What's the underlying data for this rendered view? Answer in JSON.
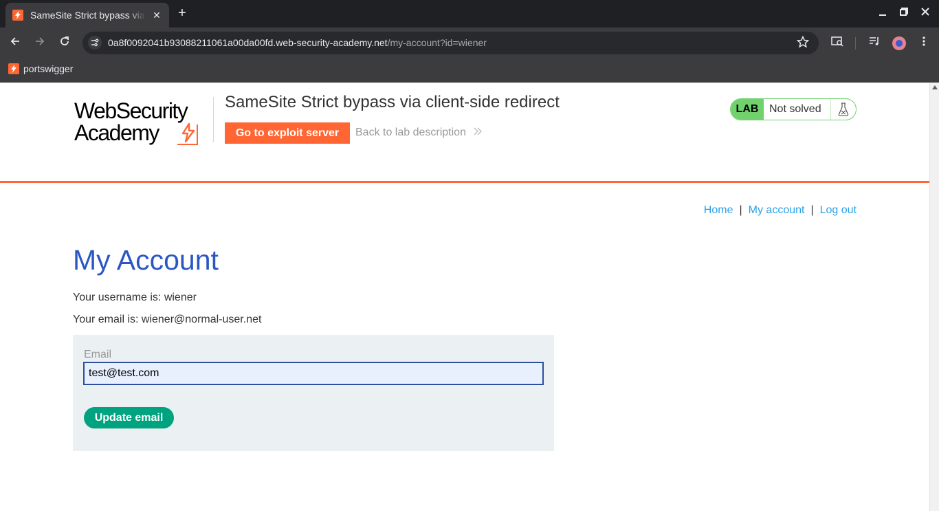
{
  "browser": {
    "tab_title": "SameSite Strict bypass via client-side redirect",
    "tab_close": "✕",
    "new_tab": "+",
    "url_host": "0a8f0092041b93088211061a00da00fd.web-security-academy.net",
    "url_path": "/my-account?id=wiener",
    "bookmark": "portswigger",
    "favicon_color": "#ff6633"
  },
  "lab_header": {
    "logo_line1": "WebSecurity",
    "logo_line2": "Academy",
    "title": "SameSite Strict bypass via client-side redirect",
    "exploit_button": "Go to exploit server",
    "back_link": "Back to lab description",
    "badge_lab": "LAB",
    "badge_status": "Not solved"
  },
  "nav": {
    "home": "Home",
    "my_account": "My account",
    "log_out": "Log out",
    "separator": "|"
  },
  "account": {
    "heading": "My Account",
    "username_text": "Your username is: wiener",
    "email_text": "Your email is: wiener@normal-user.net",
    "email_label": "Email",
    "email_value": "test@test.com",
    "update_button": "Update email"
  },
  "colors": {
    "accent_orange": "#ff6633",
    "heading_blue": "#2c57c3",
    "link_blue": "#29a1e8",
    "button_green": "#00a37f",
    "lab_badge_green": "#70d16d"
  }
}
